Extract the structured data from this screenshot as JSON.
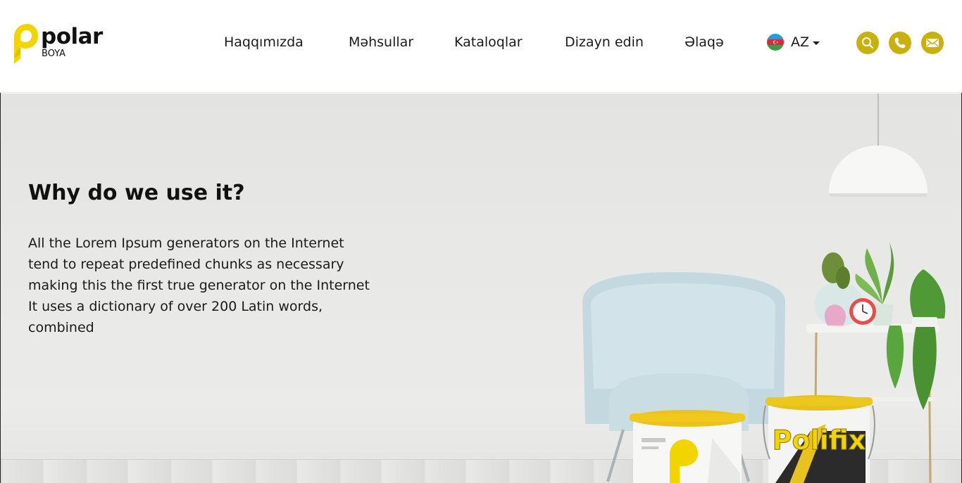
{
  "brand": {
    "name": "polar",
    "sub": "BOYA",
    "accent_color": "#c9b00a",
    "logo_yellow": "#f2d500"
  },
  "nav": {
    "items": [
      {
        "label": "Haqqımızda"
      },
      {
        "label": "Məhsullar"
      },
      {
        "label": "Kataloqlar"
      },
      {
        "label": "Dizayn edin"
      },
      {
        "label": "Əlaqə"
      }
    ]
  },
  "language": {
    "code": "AZ",
    "flag_icon": "azerbaijan-flag-icon"
  },
  "actions": {
    "search_icon": "search-icon",
    "phone_icon": "phone-icon",
    "mail_icon": "mail-icon"
  },
  "hero": {
    "title": "Why do we use it?",
    "text": "All the Lorem Ipsum generators on the Internet\ntend to repeat predefined chunks as necessary\nmaking this the first true generator on the Internet\nIt uses a dictionary of over 200 Latin words,\ncombined",
    "product_label": "Polifix"
  }
}
